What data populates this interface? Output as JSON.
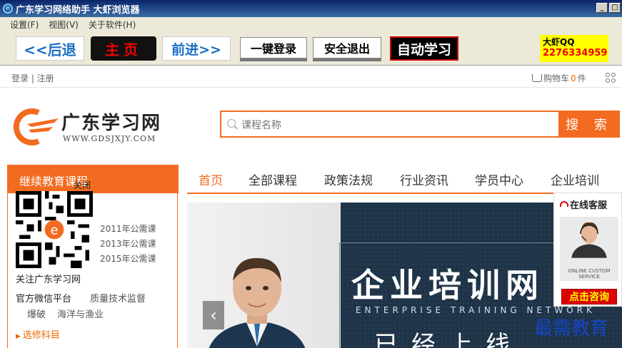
{
  "window": {
    "title": "广东学习网络助手  大虾浏览器",
    "controls": [
      "_",
      "□"
    ]
  },
  "menu": [
    "设置(F)",
    "视图(V)",
    "关于软件(H)"
  ],
  "toolbar": {
    "back": "<<后退",
    "home": "主页",
    "forward": "前进>>",
    "one_click_login": "一键登录",
    "safe_exit": "安全退出",
    "auto_study": "自动学习",
    "qq_label": "大虾QQ",
    "qq_number": "2276334959"
  },
  "site_top": {
    "login": "登录 | 注册",
    "cart_label": "购物车",
    "cart_count": "0",
    "cart_unit": "件"
  },
  "logo": {
    "title": "广东学习网",
    "subtitle": "WWW.GDSJXJY.COM"
  },
  "search": {
    "placeholder": "课程名称",
    "button": "搜 索"
  },
  "left_panel": {
    "heading": "继续教育课程",
    "close": "关闭",
    "years": [
      "2011年公需课",
      "2013年公需课",
      "2015年公需课"
    ],
    "qr_caption": "关注广东学习网",
    "qr_caption2": "官方微信平台",
    "category_a": "质量技术监督",
    "category_b": "爆破",
    "category_c": "海洋与渔业",
    "elective": "选修科目"
  },
  "nav": [
    "首页",
    "全部课程",
    "政策法规",
    "行业资讯",
    "学员中心",
    "企业培训"
  ],
  "banner": {
    "title": "企业培训网",
    "subtitle": "ENTERPRISE TRAINING NETWORK",
    "more": "已经上线"
  },
  "service": {
    "title": "在线客服",
    "image_caption": "ONLINE CUSTOM SERVICE",
    "consult": "点击咨询"
  },
  "watermark": "最需教育",
  "colors": {
    "accent": "#f36b21",
    "titlebar": "#0a246a",
    "toolbar_bg": "#ece9d8"
  }
}
